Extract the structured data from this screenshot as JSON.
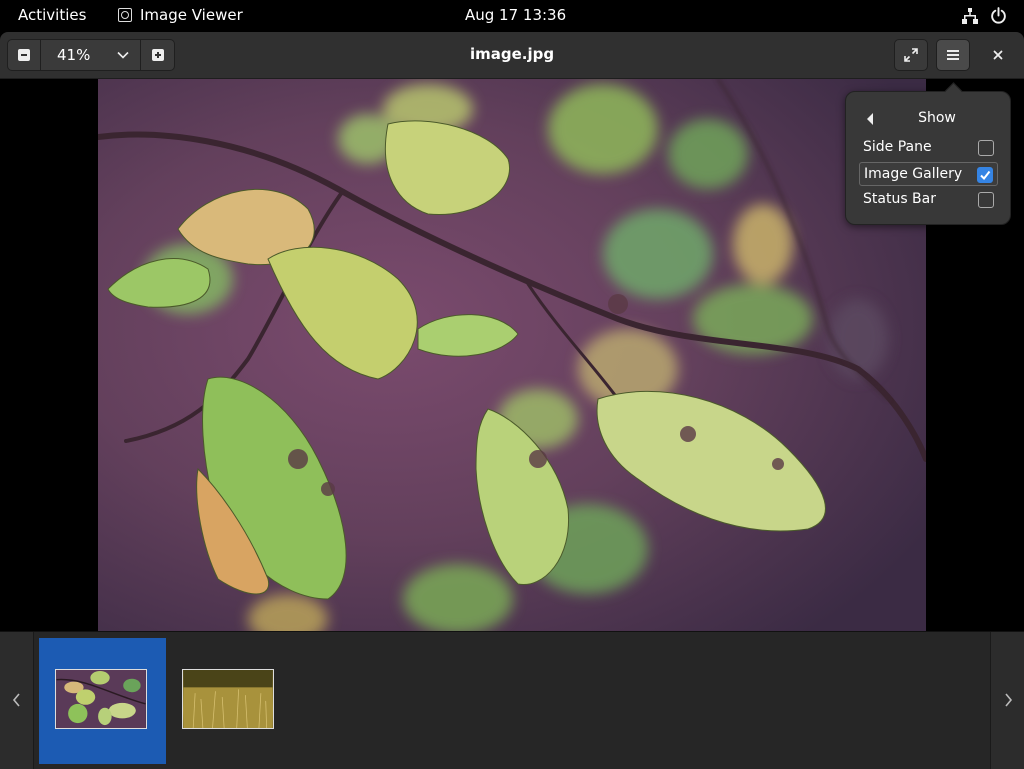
{
  "topbar": {
    "activities": "Activities",
    "app_name": "Image Viewer",
    "clock": "Aug 17  13:36"
  },
  "headerbar": {
    "zoom_value": "41%",
    "title": "image.jpg"
  },
  "popover": {
    "title": "Show",
    "items": [
      {
        "label": "Side Pane",
        "checked": false
      },
      {
        "label": "Image Gallery",
        "checked": true
      },
      {
        "label": "Status Bar",
        "checked": false
      }
    ]
  },
  "gallery": {
    "selected_index": 0,
    "thumbnail_count": 2
  },
  "colors": {
    "accent": "#3584e4",
    "selection": "#1c5bb3"
  }
}
